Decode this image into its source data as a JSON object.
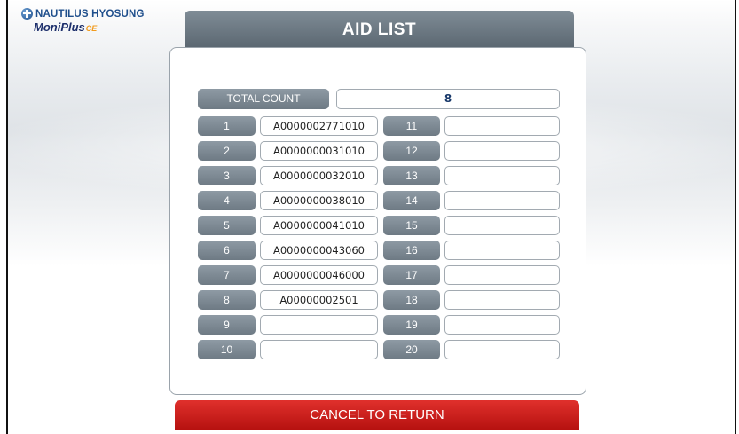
{
  "logo": {
    "line1": "NAUTILUS HYOSUNG",
    "line2": "MoniPlus",
    "line2_suffix": "CE"
  },
  "title": "AID LIST",
  "total": {
    "label": "TOTAL COUNT",
    "value": "8"
  },
  "left_rows": [
    {
      "num": "1",
      "value": "A0000002771010"
    },
    {
      "num": "2",
      "value": "A0000000031010"
    },
    {
      "num": "3",
      "value": "A0000000032010"
    },
    {
      "num": "4",
      "value": "A0000000038010"
    },
    {
      "num": "5",
      "value": "A0000000041010"
    },
    {
      "num": "6",
      "value": "A0000000043060"
    },
    {
      "num": "7",
      "value": "A0000000046000"
    },
    {
      "num": "8",
      "value": "A00000002501"
    },
    {
      "num": "9",
      "value": ""
    },
    {
      "num": "10",
      "value": ""
    }
  ],
  "right_rows": [
    {
      "num": "11",
      "value": ""
    },
    {
      "num": "12",
      "value": ""
    },
    {
      "num": "13",
      "value": ""
    },
    {
      "num": "14",
      "value": ""
    },
    {
      "num": "15",
      "value": ""
    },
    {
      "num": "16",
      "value": ""
    },
    {
      "num": "17",
      "value": ""
    },
    {
      "num": "18",
      "value": ""
    },
    {
      "num": "19",
      "value": ""
    },
    {
      "num": "20",
      "value": ""
    }
  ],
  "cancel_label": "CANCEL TO RETURN",
  "colors": {
    "title_bar": "#6b7781",
    "label": "#7d8993",
    "cancel": "#cc1e1b",
    "brand": "#1f4f8c",
    "accent": "#f29b1d"
  }
}
